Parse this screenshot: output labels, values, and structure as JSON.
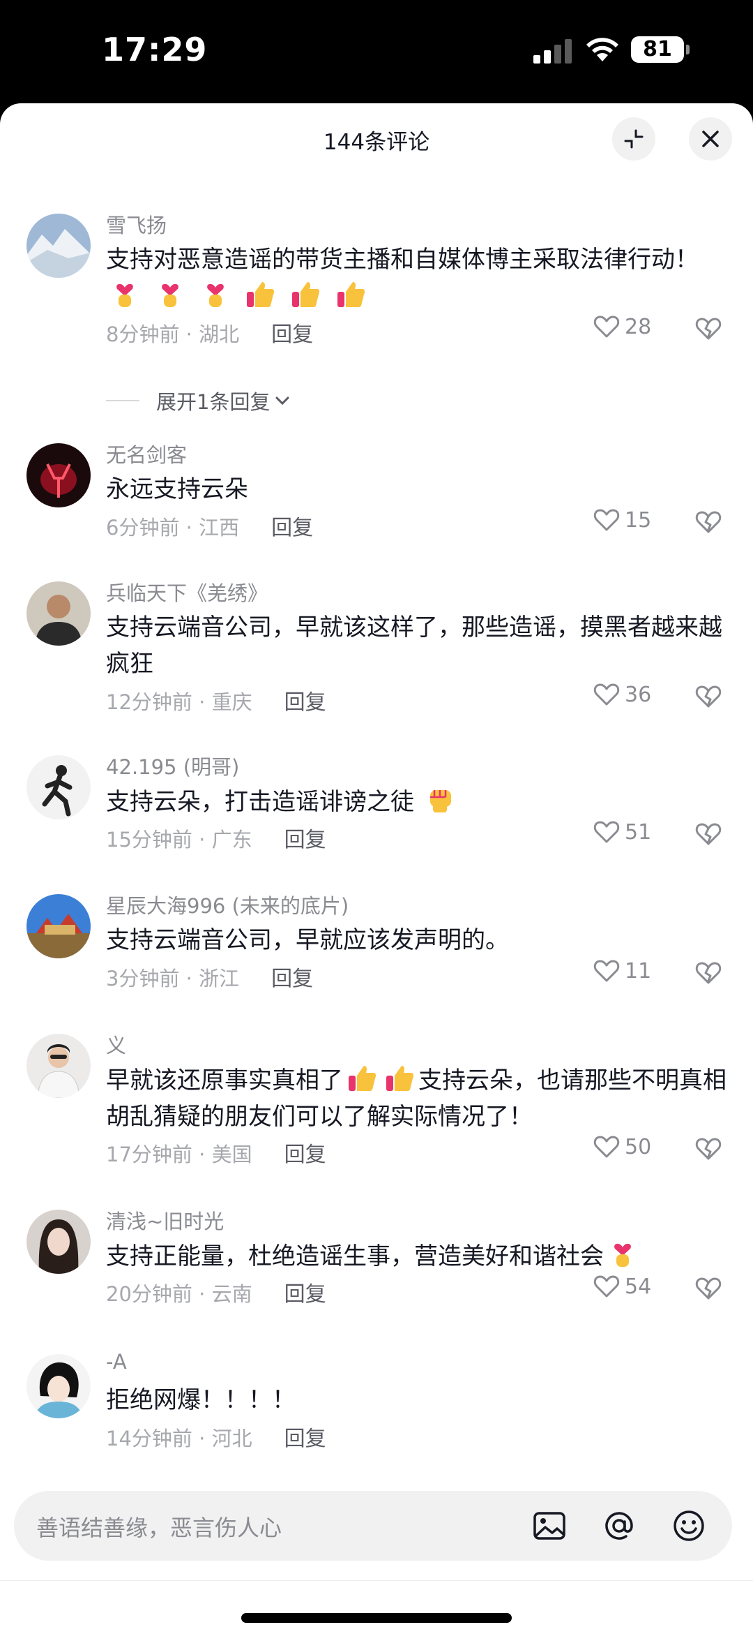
{
  "status_bar": {
    "time": "17:29",
    "battery": "81"
  },
  "sheet": {
    "title": "144条评论"
  },
  "comments": [
    {
      "user": "雪飞扬",
      "text": "支持对恶意造谣的带货主播和自媒体博主采取法律行动！",
      "emoji_icons": [
        "finger-heart-icon",
        "finger-heart-icon",
        "finger-heart-icon",
        "thumbs-up-icon",
        "thumbs-up-icon",
        "thumbs-up-icon"
      ],
      "time": "8分钟前",
      "location": "湖北",
      "reply": "回复",
      "likes": "28"
    },
    {
      "user": "无名剑客",
      "text": "永远支持云朵",
      "emoji_icons": [],
      "time": "6分钟前",
      "location": "江西",
      "reply": "回复",
      "likes": "15"
    },
    {
      "user": "兵临天下《羌绣》",
      "text": "支持云端音公司，早就该这样了，那些造谣，摸黑者越来越疯狂",
      "emoji_icons": [],
      "time": "12分钟前",
      "location": "重庆",
      "reply": "回复",
      "likes": "36"
    },
    {
      "user": "42.195 (明哥)",
      "text": "支持云朵，打击造谣诽谤之徒",
      "emoji_icons": [
        "raised-fist-icon"
      ],
      "time": "15分钟前",
      "location": "广东",
      "reply": "回复",
      "likes": "51"
    },
    {
      "user": "星辰大海996 (未来的底片)",
      "text": "支持云端音公司，早就应该发声明的。",
      "emoji_icons": [],
      "time": "3分钟前",
      "location": "浙江",
      "reply": "回复",
      "likes": "11"
    },
    {
      "user": "义",
      "text_before": "早就该还原事实真相了",
      "text_after": "支持云朵，也请那些不明真相胡乱猜疑的朋友们可以了解实际情况了！",
      "emoji_icons": [
        "thumbs-up-icon",
        "thumbs-up-icon"
      ],
      "time": "17分钟前",
      "location": "美国",
      "reply": "回复",
      "likes": "50"
    },
    {
      "user": "清浅~旧时光",
      "text": "支持正能量，杜绝造谣生事，营造美好和谐社会",
      "emoji_icons": [
        "finger-heart-icon"
      ],
      "time": "20分钟前",
      "location": "云南",
      "reply": "回复",
      "likes": "54"
    },
    {
      "user": "-A",
      "text": "拒绝网爆！！！！",
      "emoji_icons": [],
      "time": "14分钟前",
      "location": "河北",
      "reply": "回复",
      "likes": ""
    }
  ],
  "expand_replies": "展开1条回复",
  "input": {
    "placeholder": "善语结善缘，恶言伤人心"
  },
  "colors": {
    "like_gray": "#8a8b91",
    "text": "#161823",
    "emoji_yellow": "#f9c23c",
    "emoji_pink": "#e8336d"
  }
}
